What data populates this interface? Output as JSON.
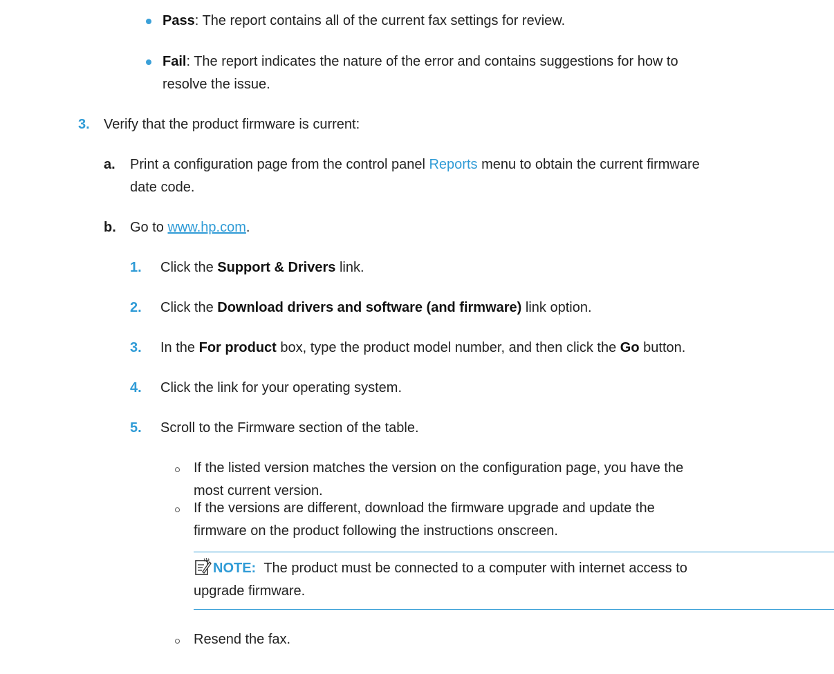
{
  "bullets": [
    {
      "term": "Pass",
      "text": ": The report contains all of the current fax settings for review."
    },
    {
      "term": "Fail",
      "text_line1": ": The report indicates the nature of the error and contains suggestions for how to",
      "text_line2": "resolve the issue."
    }
  ],
  "step3": {
    "number": "3.",
    "text": "Verify that the product firmware is current:",
    "a": {
      "letter": "a.",
      "text_pre": "Print a configuration page from the control panel ",
      "menu_link": "Reports",
      "text_post": " menu to obtain the current firmware",
      "text_line2": "date code."
    },
    "b": {
      "letter": "b.",
      "text_pre": "Go to ",
      "url": "www.hp.com",
      "text_post": ".",
      "substeps": [
        {
          "num": "1.",
          "pre": "Click the ",
          "bold": "Support & Drivers",
          "post": " link."
        },
        {
          "num": "2.",
          "pre": "Click the ",
          "bold": "Download drivers and software (and firmware)",
          "post": " link option."
        },
        {
          "num": "3.",
          "pre": "In the ",
          "bold": "For product",
          "mid": " box, type the product model number, and then click the ",
          "bold2": "Go",
          "post": " button."
        },
        {
          "num": "4.",
          "pre": "Click the link for your operating system.",
          "bold": "",
          "post": ""
        },
        {
          "num": "5.",
          "pre": "Scroll to the Firmware section of the table.",
          "bold": "",
          "post": ""
        }
      ],
      "subbullets": [
        {
          "line1": "If the listed version matches the version on the configuration page, you have the",
          "line2": "most current version."
        },
        {
          "line1": "If the versions are different, download the firmware upgrade and update the",
          "line2": "firmware on the product following the instructions onscreen."
        }
      ],
      "note": {
        "label": "NOTE:",
        "line1": "The product must be connected to a computer with internet access to",
        "line2": "upgrade firmware."
      },
      "final_bullet": "Resend the fax."
    }
  }
}
